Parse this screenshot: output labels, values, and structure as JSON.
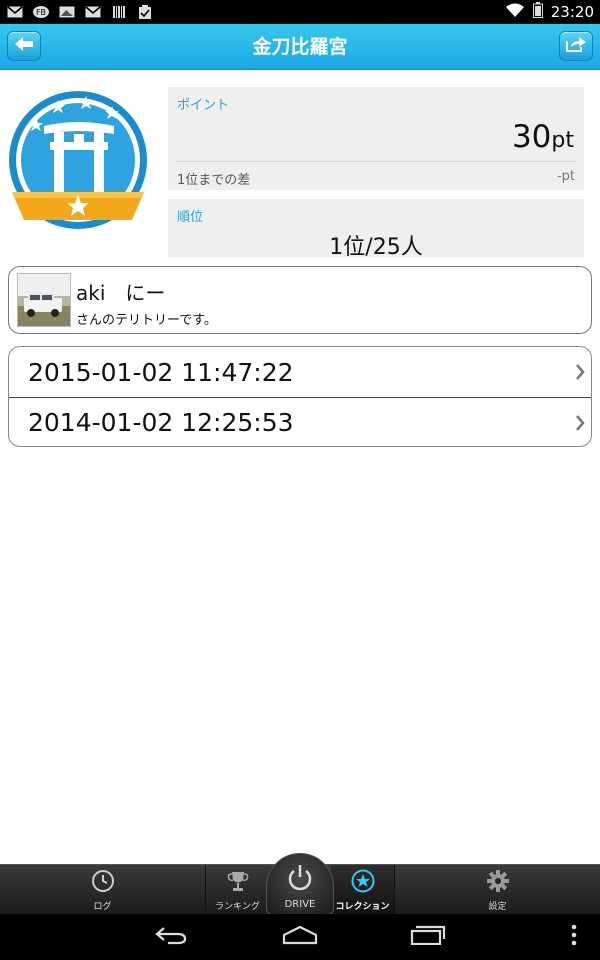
{
  "status_bar": {
    "left_icons": [
      "gmail-icon",
      "app-icon",
      "image-icon",
      "gmail-icon",
      "barcode-icon",
      "clipboard-check-icon"
    ],
    "right_icons": [
      "wifi-icon",
      "battery-icon"
    ],
    "time": "23:20"
  },
  "action_bar": {
    "title": "金刀比羅宮",
    "back_icon": "back-arrow-icon",
    "share_icon": "share-icon",
    "accent_color": "#1eb2e8"
  },
  "badge": {
    "icon": "torii-gate-badge-icon"
  },
  "points": {
    "label": "ポイント",
    "value": "30",
    "unit": "pt",
    "gap_label": "1位までの差",
    "gap_value": "-pt"
  },
  "rank": {
    "label": "順位",
    "value": "1位/25人"
  },
  "owner": {
    "name": "aki　にー",
    "subtitle": "さんのテリトリーです。"
  },
  "history": [
    {
      "datetime": "2015-01-02 11:47:22"
    },
    {
      "datetime": "2014-01-02 12:25:53"
    }
  ],
  "tabs": {
    "log": "ログ",
    "ranking": "ランキング",
    "drive": "DRIVE",
    "collection": "コレクション",
    "settings": "設定",
    "active_color": "#3cc4f2"
  }
}
